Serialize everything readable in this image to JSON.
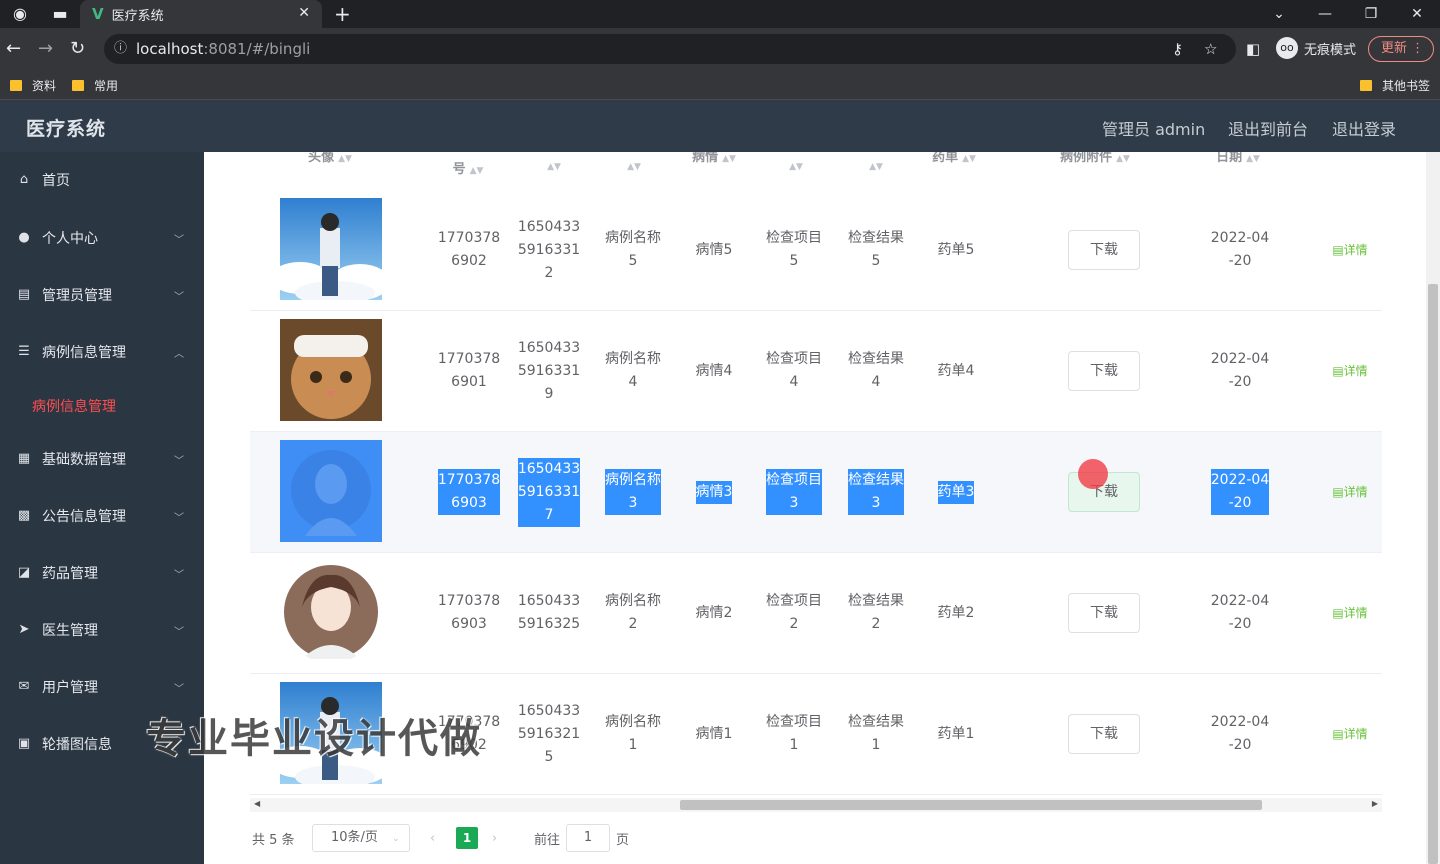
{
  "browser": {
    "tab_title": "医疗系统",
    "url_host": "localhost",
    "url_rest": ":8081/#/bingli",
    "incognito": "无痕模式",
    "update": "更新",
    "bookmarks": [
      "资料",
      "常用"
    ],
    "other_bookmarks": "其他书签"
  },
  "app": {
    "brand": "医疗系统",
    "header_links": [
      "管理员 admin",
      "退出到前台",
      "退出登录"
    ]
  },
  "sidebar": {
    "items": [
      {
        "label": "首页",
        "icon": "home-icon"
      },
      {
        "label": "个人中心",
        "icon": "user-icon"
      },
      {
        "label": "管理员管理",
        "icon": "clipboard-icon"
      },
      {
        "label": "病例信息管理",
        "icon": "list-icon"
      },
      {
        "label": "基础数据管理",
        "icon": "grid-icon"
      },
      {
        "label": "公告信息管理",
        "icon": "table-icon"
      },
      {
        "label": "药品管理",
        "icon": "chart-icon"
      },
      {
        "label": "医生管理",
        "icon": "send-icon"
      },
      {
        "label": "用户管理",
        "icon": "mail-icon"
      },
      {
        "label": "轮播图信息",
        "icon": "doc-icon"
      }
    ],
    "active_sub": "病例信息管理"
  },
  "table": {
    "headers": [
      "头像",
      "号",
      "",
      "",
      "病情",
      "",
      "",
      "药单",
      "病例附件",
      "日期"
    ],
    "rows": [
      {
        "phone": "17703786902",
        "code": "165043359163312",
        "name": "病例名称5",
        "illness": "病情5",
        "item": "检查项目5",
        "result": "检查结果5",
        "rx": "药单5",
        "download": "下载",
        "date": "2022-04-20",
        "detail": "详情",
        "avatar": "boy-clouds"
      },
      {
        "phone": "17703786901",
        "code": "165043359163319",
        "name": "病例名称4",
        "illness": "病情4",
        "item": "检查项目4",
        "result": "检查结果4",
        "rx": "药单4",
        "download": "下载",
        "date": "2022-04-20",
        "detail": "详情",
        "avatar": "cat"
      },
      {
        "phone": "17703786903",
        "code": "165043359163317",
        "name": "病例名称3",
        "illness": "病情3",
        "item": "检查项目3",
        "result": "检查结果3",
        "rx": "药单3",
        "download": "下载",
        "date": "2022-04-20",
        "detail": "详情",
        "avatar": "girl-blue"
      },
      {
        "phone": "17703786903",
        "code": "16504335916325",
        "name": "病例名称2",
        "illness": "病情2",
        "item": "检查项目2",
        "result": "检查结果2",
        "rx": "药单2",
        "download": "下载",
        "date": "2022-04-20",
        "detail": "详情",
        "avatar": "girl-circle"
      },
      {
        "phone": "17703786902",
        "code": "165043359163215",
        "name": "病例名称1",
        "illness": "病情1",
        "item": "检查项目1",
        "result": "检查结果1",
        "rx": "药单1",
        "download": "下载",
        "date": "2022-04-20",
        "detail": "详情",
        "avatar": "boy-clouds"
      }
    ]
  },
  "pagination": {
    "total": "共 5 条",
    "page_size": "10条/页",
    "current": "1",
    "goto_label": "前往",
    "goto_value": "1",
    "page_unit": "页"
  },
  "watermark": "专业毕业设计代做"
}
